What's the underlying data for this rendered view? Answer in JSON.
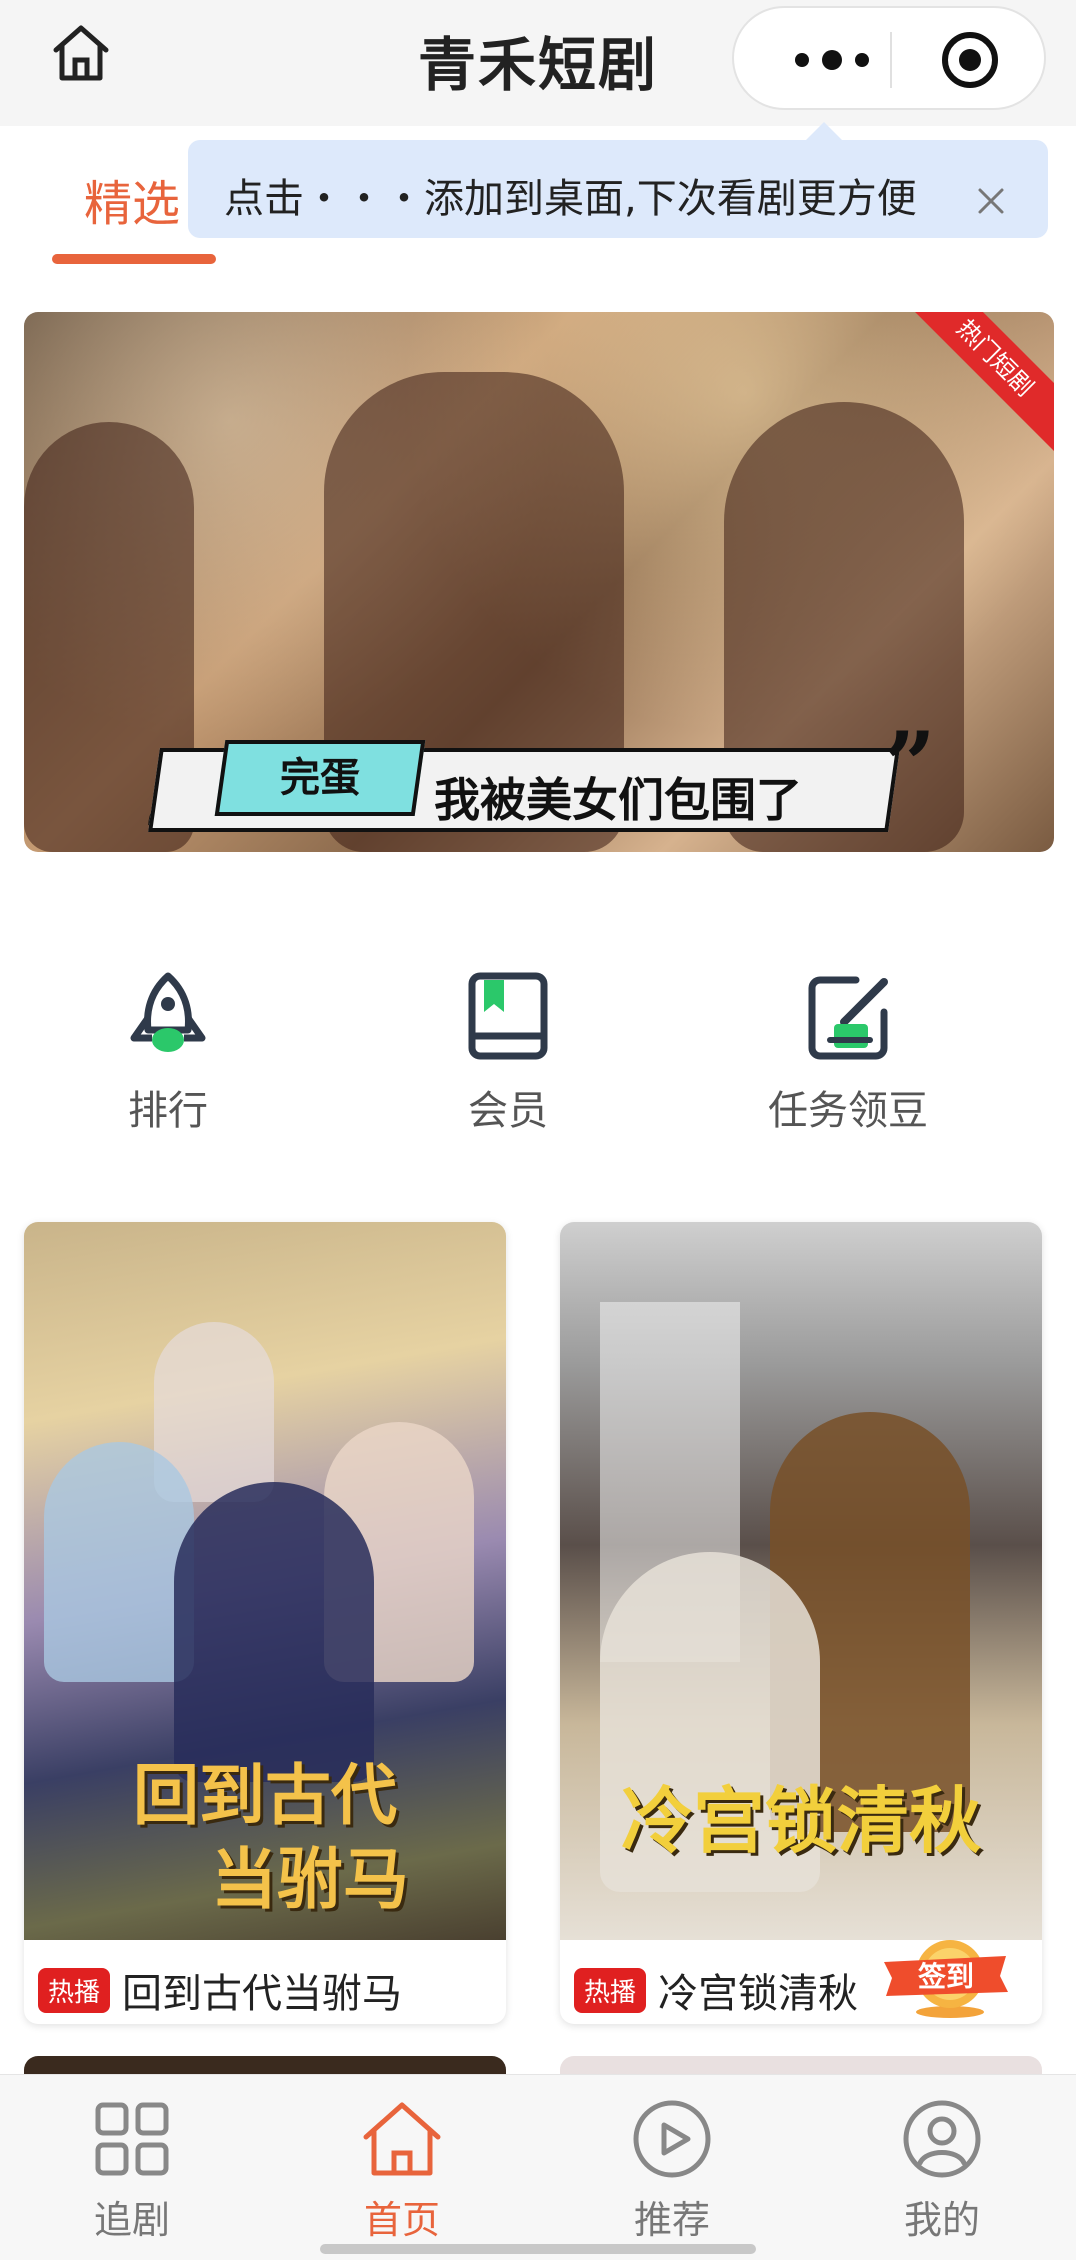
{
  "app": {
    "title": "青禾短剧"
  },
  "tabs": {
    "selected": "精选"
  },
  "tooltip": {
    "text": "点击・・・添加到桌面,下次看剧更方便"
  },
  "banner": {
    "corner_label": "热门短剧",
    "caption_tag": "完蛋",
    "caption_text": "我被美女们包围了"
  },
  "quick_menu": [
    {
      "label": "排行",
      "icon": "rocket-icon"
    },
    {
      "label": "会员",
      "icon": "book-icon"
    },
    {
      "label": "任务领豆",
      "icon": "task-edit-icon"
    }
  ],
  "dramas": [
    {
      "poster_title_line1": "回到古代",
      "poster_title_line2": "当驸马",
      "badge": "热播",
      "name": "回到古代当驸马"
    },
    {
      "poster_title": "冷宫锁清秋",
      "badge": "热播",
      "name": "冷宫锁清秋"
    }
  ],
  "sign_in": {
    "label": "签到"
  },
  "bottom_nav": [
    {
      "label": "追剧",
      "icon": "grid-icon",
      "active": false
    },
    {
      "label": "首页",
      "icon": "home-icon",
      "active": true
    },
    {
      "label": "推荐",
      "icon": "play-circle-icon",
      "active": false
    },
    {
      "label": "我的",
      "icon": "user-icon",
      "active": false
    }
  ],
  "colors": {
    "accent": "#e8643c",
    "hot_badge": "#e02020",
    "tooltip_bg": "#dde9fb",
    "icon_green": "#2bc86a"
  }
}
